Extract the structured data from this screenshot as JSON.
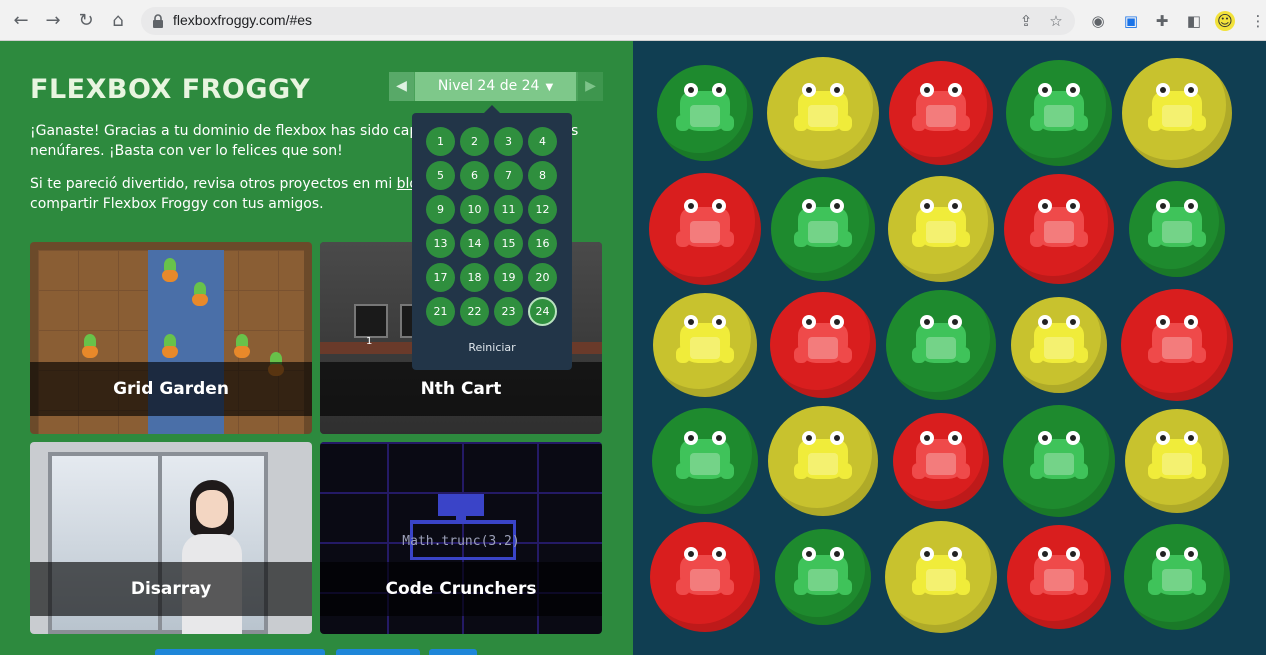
{
  "browser": {
    "url": "flexboxfroggy.com/#es"
  },
  "game": {
    "title": "FLEXBOX FROGGY",
    "level_label": "Nivel 24 de 24",
    "prev_arrow": "◀",
    "next_arrow": "▶"
  },
  "message": {
    "line1": "¡Ganaste! Gracias a tu dominio de flexbox has sido capaz lle",
    "line1_tail": "s",
    "line2": "nenúfares. ¡Basta con ver lo felices que son!",
    "line3_pre": "Si te pareció divertido, revisa otros proyectos en mi ",
    "blog_link": "blog",
    "line3_mid": " o ",
    "other_link": "T",
    "line4": "compartir Flexbox Froggy con tus amigos."
  },
  "projects": [
    {
      "name": "Grid Garden"
    },
    {
      "name": "Nth Cart"
    },
    {
      "name": "Disarray"
    },
    {
      "name": "Code Crunchers"
    }
  ],
  "nth_cart_counter": "1",
  "code_crunchers_code": "Math.trunc(3.2)",
  "level_menu": {
    "levels": [
      "1",
      "2",
      "3",
      "4",
      "5",
      "6",
      "7",
      "8",
      "9",
      "10",
      "11",
      "12",
      "13",
      "14",
      "15",
      "16",
      "17",
      "18",
      "19",
      "20",
      "21",
      "22",
      "23",
      "24"
    ],
    "current": "24",
    "reset_label": "Reiniciar"
  },
  "board": {
    "colors": {
      "green_pad": "#1e8a2e",
      "yellow_pad": "#c8c22e",
      "red_pad": "#d91e1e",
      "green_frog": "#3fc35a",
      "yellow_frog": "#f0ec3a",
      "red_frog": "#ef4a4a"
    },
    "rows": [
      [
        "green",
        "yellow",
        "red",
        "green",
        "yellow"
      ],
      [
        "red",
        "green",
        "yellow",
        "red",
        "green"
      ],
      [
        "yellow",
        "red",
        "green",
        "yellow",
        "red"
      ],
      [
        "green",
        "yellow",
        "red",
        "green",
        "yellow"
      ],
      [
        "red",
        "green",
        "yellow",
        "red",
        "green"
      ]
    ]
  }
}
